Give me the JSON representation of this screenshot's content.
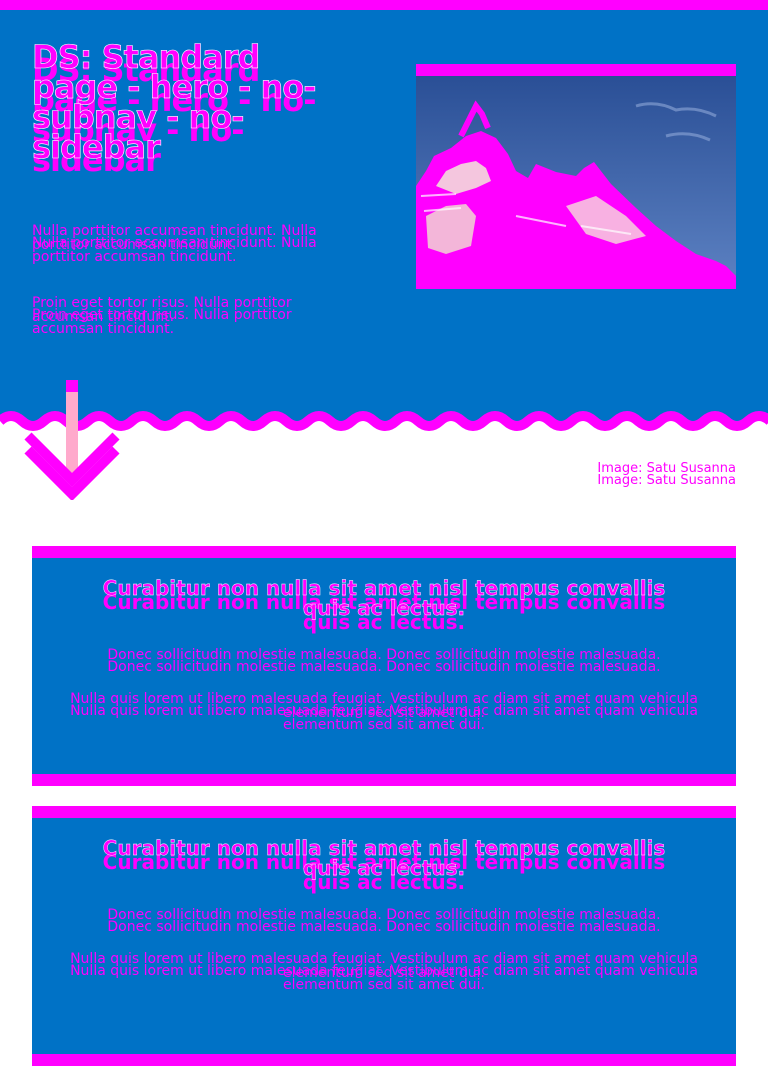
{
  "hero": {
    "title": "DS: Standard page - hero - no-subnav - no-sidebar",
    "paragraph_1": "Nulla porttitor accumsan tincidunt. Nulla porttitor accumsan tincidunt.",
    "paragraph_2": "Proin eget tortor risus. Nulla porttitor accumsan tincidunt.",
    "image_credit": "Image: Satu Susanna"
  },
  "cards": [
    {
      "heading": "Curabitur non nulla sit amet nisl tempus convallis quis ac lectus.",
      "paragraph_1": "Donec sollicitudin molestie malesuada. Donec sollicitudin molestie malesuada.",
      "paragraph_2": "Nulla quis lorem ut libero malesuada feugiat. Vestibulum ac diam sit amet quam vehicula elementum sed sit amet dui."
    },
    {
      "heading": "Curabitur non nulla sit amet nisl tempus convallis quis ac lectus.",
      "paragraph_1": "Donec sollicitudin molestie malesuada. Donec sollicitudin molestie malesuada.",
      "paragraph_2": "Nulla quis lorem ut libero malesuada feugiat. Vestibulum ac diam sit amet quam vehicula elementum sed sit amet dui."
    }
  ],
  "icons": {
    "scroll_down": "arrow-down-icon"
  },
  "colors": {
    "primary_blue": "#0072c6",
    "accent_magenta": "#ff00ff",
    "background": "#ffffff"
  }
}
